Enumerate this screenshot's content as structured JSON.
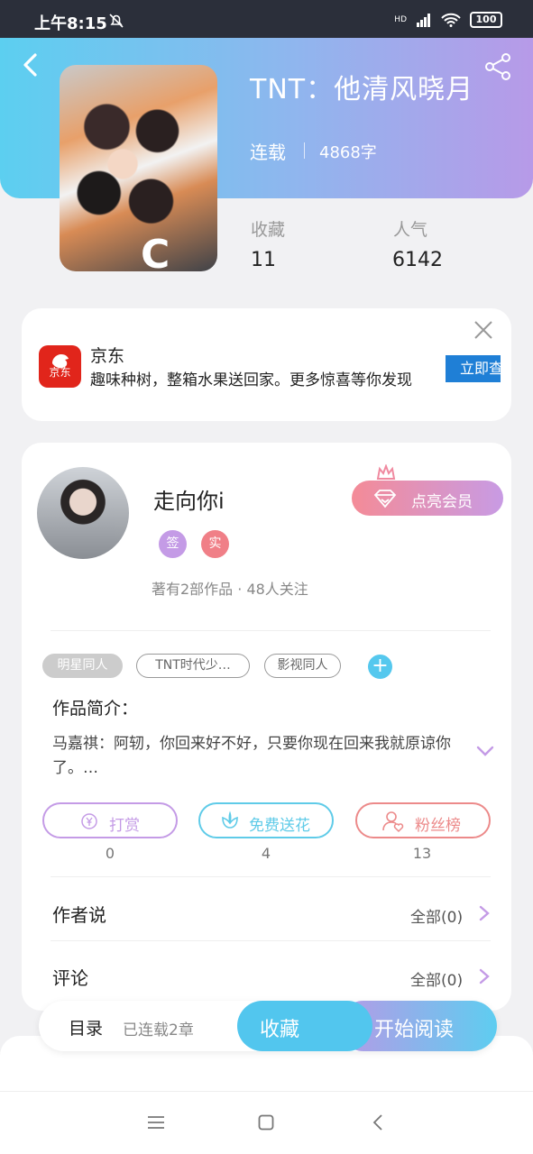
{
  "status_bar": {
    "time": "上午8:15",
    "network": "HD",
    "battery": "100"
  },
  "book": {
    "title": "TNT：他清风晓月",
    "status": "连载",
    "word_count": "4868字",
    "favorites_label": "收藏",
    "favorites": "11",
    "popularity_label": "人气",
    "popularity": "6142"
  },
  "ad": {
    "name": "京东",
    "logo_text": "京东",
    "description": "趣味种树，整箱水果送回家。更多惊喜等你发现",
    "cta": "立即查看"
  },
  "author": {
    "name": "走向你i",
    "badge_sign": "签",
    "badge_real": "实",
    "meta": "著有2部作品 · 48人关注",
    "vip_button": "点亮会员"
  },
  "tags": [
    "明星同人",
    "TNT时代少…",
    "影视同人"
  ],
  "intro": {
    "heading": "作品简介：",
    "text": "马嘉祺：阿轫，你回来好不好，只要你现在回来我就原谅你了。…"
  },
  "actions": [
    {
      "label": "打赏",
      "count": "0",
      "color": "#c49be6"
    },
    {
      "label": "免费送花",
      "count": "4",
      "color": "#5fcbe8"
    },
    {
      "label": "粉丝榜",
      "count": "13",
      "color": "#ec8a8a"
    }
  ],
  "rows": [
    {
      "title": "作者说",
      "right": "全部(0)"
    },
    {
      "title": "评论",
      "right": "全部(0)"
    }
  ],
  "bottom_bar": {
    "toc": "目录",
    "toc_sub": "已连载2章",
    "favorite": "收藏",
    "read": "开始阅读"
  }
}
